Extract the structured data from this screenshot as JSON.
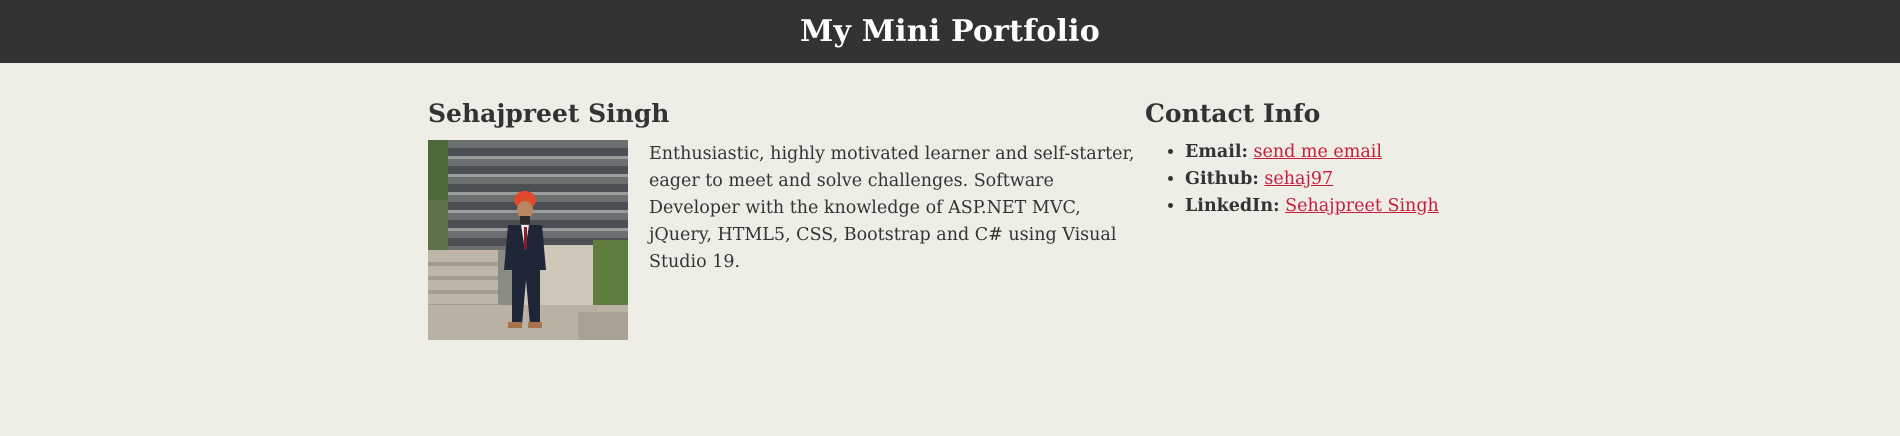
{
  "header": {
    "title": "My Mini Portfolio"
  },
  "profile": {
    "name": "Sehajpreet Singh",
    "bio": "Enthusiastic, highly motivated learner and self-starter, eager to meet and solve challenges. Software Developer with the knowledge of ASP.NET MVC, jQuery, HTML5, CSS, Bootstrap and C# using Visual Studio 19.",
    "photo_icon": "person-photo"
  },
  "contact": {
    "title": "Contact Info",
    "items": [
      {
        "label": "Email:",
        "link_text": "send me email"
      },
      {
        "label": "Github:",
        "link_text": "sehaj97"
      },
      {
        "label": "LinkedIn:",
        "link_text": "Sehajpreet Singh"
      }
    ]
  },
  "colors": {
    "header_bg": "#333333",
    "page_bg": "#efeee6",
    "link": "#c41e3a",
    "text": "#333333"
  }
}
